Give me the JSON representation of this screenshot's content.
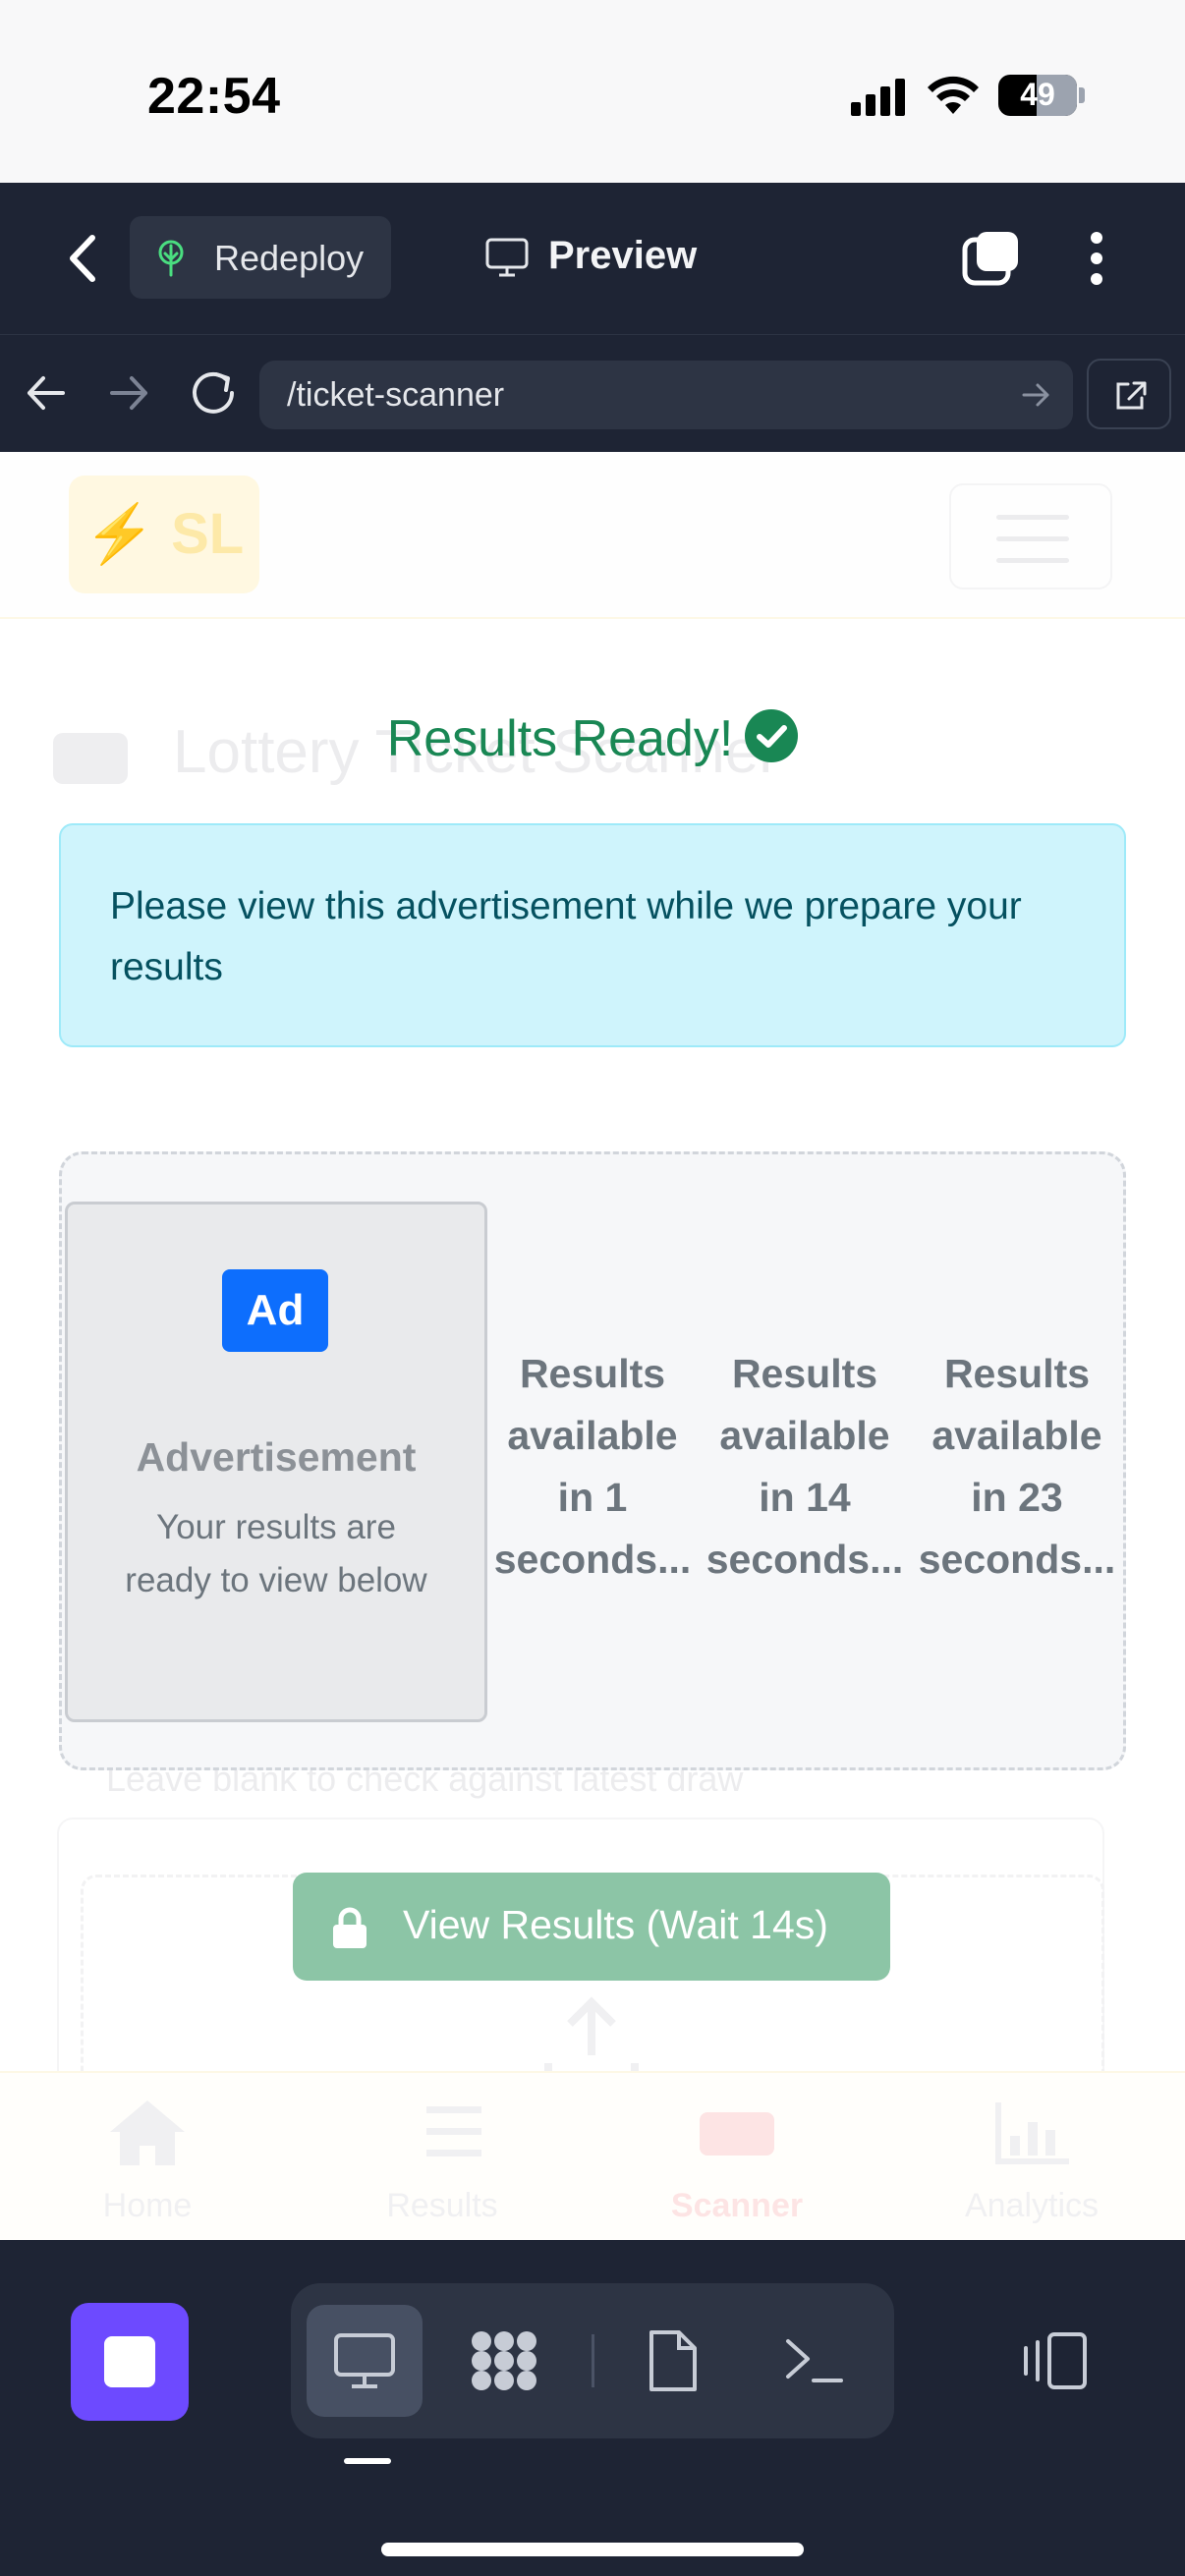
{
  "status_bar": {
    "time": "22:54",
    "battery": "49",
    "battery_level": 0.49
  },
  "app_header": {
    "redeploy_label": "Redeploy",
    "preview_label": "Preview"
  },
  "browser": {
    "url": "/ticket-scanner"
  },
  "background_page": {
    "logo_text": "SL",
    "title": "Lottery Ticket Scanner",
    "draw_hint": "Leave blank to check against latest draw",
    "bottom_nav": [
      {
        "label": "Home",
        "icon": "home-icon"
      },
      {
        "label": "Results",
        "icon": "list-ordered-icon"
      },
      {
        "label": "Scanner",
        "icon": "ticket-icon"
      },
      {
        "label": "Analytics",
        "icon": "bar-chart-icon"
      }
    ]
  },
  "modal": {
    "heading": "Results Ready!",
    "info_text": "Please view this advertisement while we prepare your results",
    "ad": {
      "badge": "Ad",
      "label": "Advertisement",
      "subtext": "Your results are ready to view below"
    },
    "countdowns": [
      {
        "line1": "Results",
        "line2": "available",
        "line3": "in 1",
        "line4": "seconds..."
      },
      {
        "line1": "Results",
        "line2": "available",
        "line3": "in 14",
        "line4": "seconds..."
      },
      {
        "line1": "Results",
        "line2": "available",
        "line3": "in 23",
        "line4": "seconds..."
      }
    ],
    "view_results_label": "View Results (Wait 14s)"
  },
  "colors": {
    "chrome_dark": "#1e2434",
    "success": "#198754",
    "info_bg": "#cff4fc",
    "info_text": "#055160",
    "ad_badge": "#0d6efd",
    "stop_button": "#6d4aff"
  }
}
